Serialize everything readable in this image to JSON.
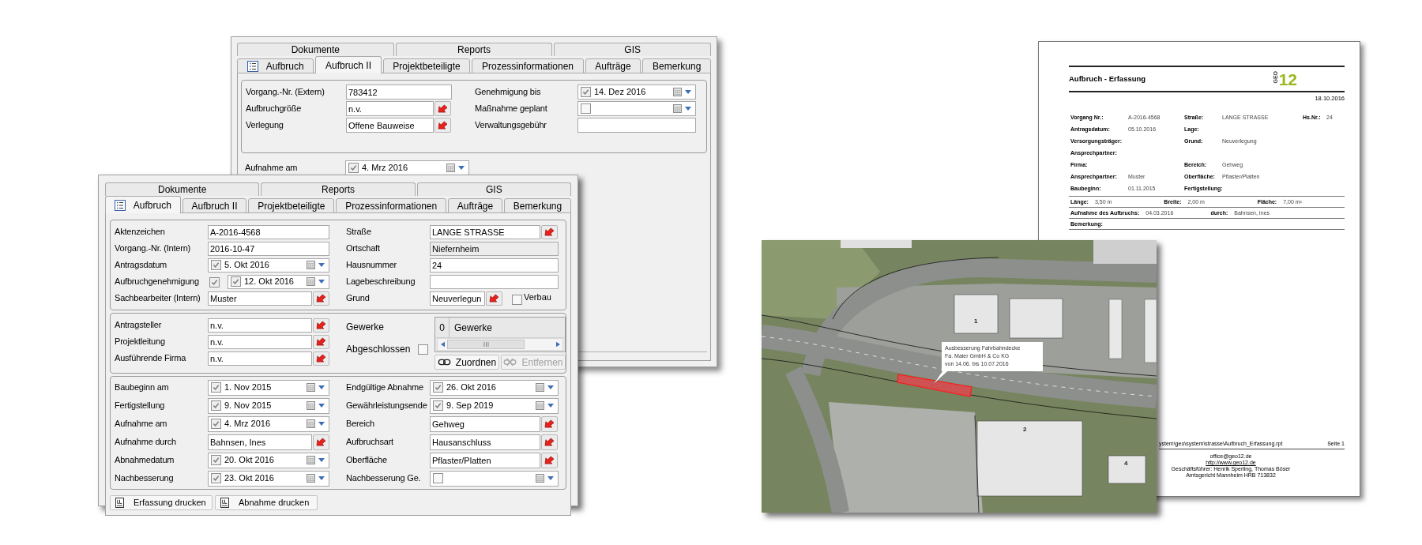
{
  "back_window": {
    "tab_rows": [
      [
        {
          "label": "Dokumente",
          "selected": false
        },
        {
          "label": "Reports",
          "selected": false
        },
        {
          "label": "GIS",
          "selected": false
        }
      ],
      [
        {
          "label": "Aufbruch",
          "selected": false
        },
        {
          "label": "Aufbruch II",
          "selected": true
        },
        {
          "label": "Projektbeteiligte",
          "selected": false
        },
        {
          "label": "Prozessinformationen",
          "selected": false
        },
        {
          "label": "Aufträge",
          "selected": false
        },
        {
          "label": "Bemerkung",
          "selected": false
        }
      ]
    ],
    "group": {
      "left": [
        {
          "kind": "text",
          "label": "Vorgang.-Nr. (Extern)",
          "value": "783412"
        },
        {
          "kind": "lookup",
          "label": "Aufbruchgröße",
          "value": "n.v."
        },
        {
          "kind": "lookup",
          "label": "Verlegung",
          "value": "Offene Bauweise"
        }
      ],
      "right": [
        {
          "kind": "date",
          "label": "Genehmigung bis",
          "checked": true,
          "value": "14. Dez 2016"
        },
        {
          "kind": "date",
          "label": "Maßnahme geplant",
          "checked": false
        },
        {
          "kind": "text",
          "label": "Verwaltungsgebühr"
        }
      ]
    },
    "extra": {
      "kind": "date",
      "label": "Aufnahme am",
      "checked": true,
      "value": "4. Mrz 2016"
    }
  },
  "front_window": {
    "tab_rows": [
      [
        {
          "label": "Dokumente",
          "selected": false
        },
        {
          "label": "Reports",
          "selected": false
        },
        {
          "label": "GIS",
          "selected": false
        }
      ],
      [
        {
          "label": "Aufbruch",
          "selected": true
        },
        {
          "label": "Aufbruch II",
          "selected": false
        },
        {
          "label": "Projektbeteiligte",
          "selected": false
        },
        {
          "label": "Prozessinformationen",
          "selected": false
        },
        {
          "label": "Aufträge",
          "selected": false
        },
        {
          "label": "Bemerkung",
          "selected": false
        }
      ]
    ],
    "sections": [
      {
        "left": [
          {
            "kind": "text",
            "label": "Aktenzeichen",
            "value": "A-2016-4568"
          },
          {
            "kind": "text",
            "label": "Vorgang.-Nr. (Intern)",
            "value": "2016-10-47"
          },
          {
            "kind": "date",
            "label": "Antragsdatum",
            "checked": true,
            "value": "5. Okt 2016"
          },
          {
            "kind": "flag_date",
            "label": "Aufbruchgenehmigung",
            "flag_checked": true,
            "checked": true,
            "value": "12. Okt 2016"
          },
          {
            "kind": "lookup",
            "label": "Sachbearbeiter (Intern)",
            "value": "Muster"
          }
        ],
        "right": [
          {
            "kind": "lookup",
            "label": "Straße",
            "value": "LANGE STRASSE"
          },
          {
            "kind": "readonly",
            "label": "Ortschaft",
            "value": "Niefernheim"
          },
          {
            "kind": "text",
            "label": "Hausnummer",
            "value": "24"
          },
          {
            "kind": "text",
            "label": "Lagebeschreibung"
          },
          {
            "kind": "lookup_option",
            "label": "Grund",
            "value": "Neuverlegun",
            "option": {
              "label": "Verbau",
              "checked": false
            }
          }
        ]
      },
      {
        "left": [
          {
            "kind": "lookup",
            "label": "Antragsteller",
            "value": "n.v."
          },
          {
            "kind": "lookup",
            "label": "Projektleitung",
            "value": "n.v."
          },
          {
            "kind": "lookup",
            "label": "Ausführende Firma",
            "value": "n.v."
          }
        ],
        "gewerke": {
          "label": "Gewerke",
          "closed": {
            "label": "Abgeschlossen",
            "checked": false
          },
          "grid": {
            "count": "0",
            "header": "Gewerke"
          },
          "buttons": [
            {
              "label": "Zuordnen",
              "disabled": false
            },
            {
              "label": "Entfernen",
              "disabled": true
            }
          ]
        }
      },
      {
        "left": [
          {
            "kind": "date",
            "label": "Baubeginn am",
            "checked": true,
            "value": "1. Nov 2015"
          },
          {
            "kind": "date",
            "label": "Fertigstellung",
            "checked": true,
            "value": "9. Nov 2015"
          },
          {
            "kind": "date",
            "label": "Aufnahme am",
            "checked": true,
            "value": "4. Mrz 2016"
          },
          {
            "kind": "lookup",
            "label": "Aufnahme durch",
            "value": "Bahnsen, Ines"
          },
          {
            "kind": "date",
            "label": "Abnahmedatum",
            "checked": true,
            "value": "20. Okt 2016"
          },
          {
            "kind": "date",
            "label": "Nachbesserung",
            "checked": true,
            "value": "23. Okt 2016"
          }
        ],
        "right": [
          {
            "kind": "date",
            "label": "Endgültige Abnahme",
            "checked": true,
            "value": "26. Okt 2016"
          },
          {
            "kind": "date",
            "label": "Gewährleistungsende",
            "checked": true,
            "value": "9. Sep 2019"
          },
          {
            "kind": "lookup",
            "label": "Bereich",
            "value": "Gehweg"
          },
          {
            "kind": "lookup",
            "label": "Aufbruchsart",
            "value": "Hausanschluss"
          },
          {
            "kind": "lookup",
            "label": "Oberfläche",
            "value": "Pflaster/Platten"
          },
          {
            "kind": "date",
            "label": "Nachbesserung Ge.",
            "checked": false
          }
        ]
      }
    ],
    "buttons": [
      {
        "label": "Erfassung drucken"
      },
      {
        "label": "Abnahme drucken"
      }
    ]
  },
  "report": {
    "title": "Aufbruch - Erfassung",
    "logo": {
      "vertical": "GEO",
      "main": "12"
    },
    "date": "18.10.2016",
    "rows": [
      {
        "left": {
          "label": "Vorgang Nr.:",
          "value": "A-2016-4568"
        },
        "middle": {
          "label": "Straße:",
          "value": "LANGE STRASSE"
        },
        "right": {
          "label": "Hs.Nr.:",
          "value": "24"
        }
      },
      {
        "left": {
          "label": "Antragsdatum:",
          "value": "05.10.2016"
        },
        "middle": {
          "label": "Lage:"
        }
      },
      {
        "left": {
          "label": "Versorgungsträger:"
        },
        "middle": {
          "label": "Grund:",
          "value": "Neuverlegung"
        }
      },
      {
        "left": {
          "label": "Ansprechpartner:"
        }
      },
      {
        "left": {
          "label": "Firma:"
        },
        "middle": {
          "label": "Bereich:",
          "value": "Gehweg"
        }
      },
      {
        "left": {
          "label": "Ansprechpartner:",
          "value": "Muster"
        },
        "middle": {
          "label": "Oberfläche:",
          "value": "Pflaster/Platten"
        }
      },
      {
        "left": {
          "label": "Baubeginn:",
          "value": "01.11.2015"
        },
        "middle": {
          "label": "Fertigstellung:"
        }
      }
    ],
    "ruled_rows": [
      {
        "items": [
          {
            "label": "Länge:",
            "value": "3,50 m"
          },
          {
            "label": "Breite:",
            "value": "2,00 m"
          },
          {
            "label": "Fläche:",
            "value": "7,00 m²"
          }
        ]
      },
      {
        "items": [
          {
            "label": "Aufnahme des Aufbruchs:",
            "value": "04.03.2016"
          },
          {
            "label": "durch:",
            "value": "Bahnsen, Ines"
          }
        ]
      },
      {
        "items": [
          {
            "label": "Bemerkung:"
          }
        ]
      }
    ],
    "footer": {
      "path": "ystem\\geo\\system\\strasse\\Aufbruch_Erfassung.rpt",
      "page": "Seite 1",
      "contact": [
        {
          "text": "office@geo12.de",
          "link": false
        },
        {
          "text": "http://www.geo12.de",
          "link": true
        },
        {
          "text": "Geschäftsführer: Henrik Sperling, Thomas Böser",
          "link": false
        },
        {
          "text": "Amtsgericht Mannheim HRB 713832",
          "link": false
        }
      ]
    }
  },
  "map": {
    "callout": [
      "Ausbesserung Fahrbahndecke",
      "Fa. Maier GmbH & Co KG",
      "von 14.06. bis 10.07.2016"
    ],
    "building_numbers": [
      "1",
      "2",
      "4"
    ]
  }
}
